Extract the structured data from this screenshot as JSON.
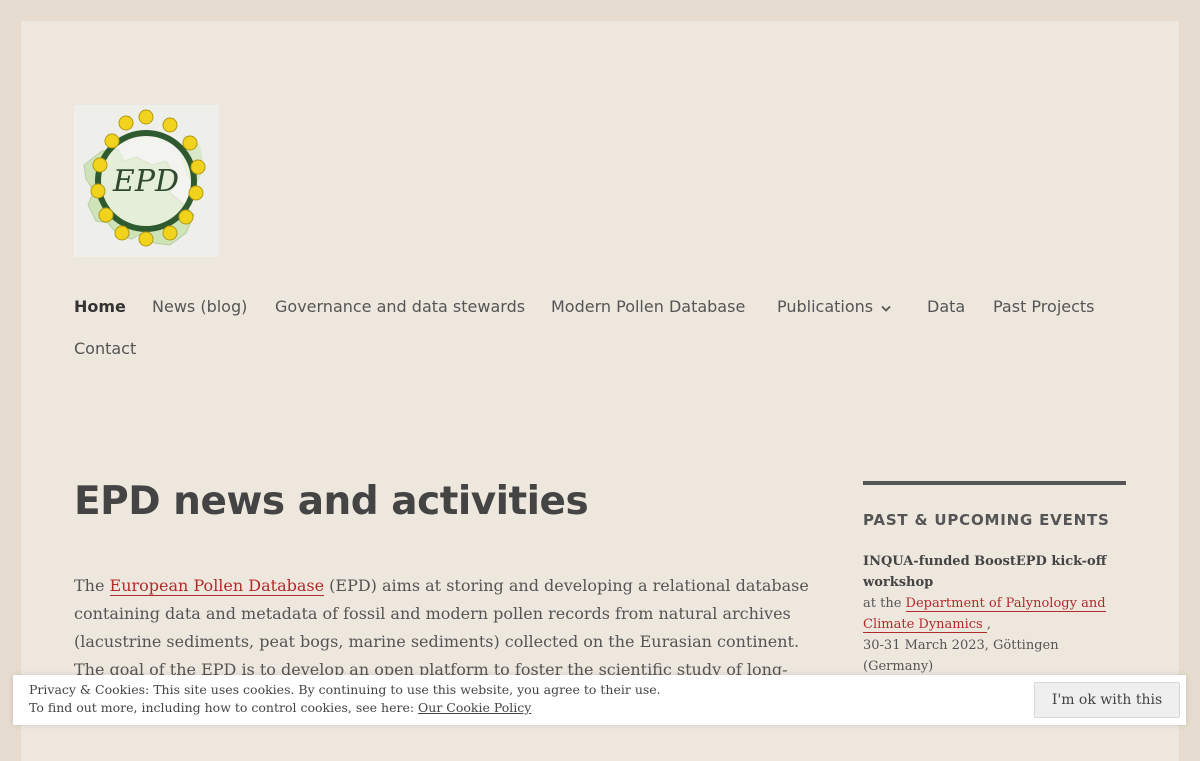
{
  "logo": {
    "text": "EPD"
  },
  "nav": {
    "items": [
      {
        "label": "Home"
      },
      {
        "label": "News (blog)"
      },
      {
        "label": "Governance and data stewards"
      },
      {
        "label": "Modern Pollen Database"
      },
      {
        "label": "Publications"
      },
      {
        "label": "Data"
      },
      {
        "label": "Past Projects"
      },
      {
        "label": "Contact"
      }
    ]
  },
  "main": {
    "title": "EPD news and activities",
    "intro": {
      "prefix": "The ",
      "link": "European Pollen Database",
      "suffix": " (EPD) aims at storing and developing a relational database containing data and metadata of fossil and modern pollen records from natural archives (lacustrine sediments, peat bogs, marine sediments) collected on the Eurasian continent. The goal of the EPD is to develop an open platform to foster the scientific study of long-term"
    }
  },
  "sidebar": {
    "title": "PAST & UPCOMING EVENTS",
    "event": {
      "title": "INQUA-funded BoostEPD kick-off workshop",
      "at_prefix": "at the ",
      "link": "Department of Palynology and Climate Dynamics ",
      "at_suffix": ",",
      "date_place": "30-31 March 2023, Göttingen (Germany)"
    }
  },
  "cookie": {
    "line1": "Privacy & Cookies: This site uses cookies. By continuing to use this website, you agree to their use.",
    "line2_prefix": "To find out more, including how to control cookies, see here: ",
    "line2_link": "Our Cookie Policy",
    "button": "I'm ok with this"
  },
  "colors": {
    "page_bg": "#e6dccf",
    "content_bg": "#ede7de",
    "link": "#b22b2b"
  }
}
